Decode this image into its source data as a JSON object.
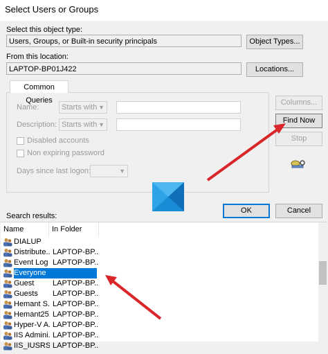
{
  "window": {
    "title": "Select Users or Groups"
  },
  "object_type": {
    "label": "Select this object type:",
    "value": "Users, Groups, or Built-in security principals",
    "button": "Object Types..."
  },
  "location": {
    "label": "From this location:",
    "value": "LAPTOP-BP01J422",
    "button": "Locations..."
  },
  "queries": {
    "tab": "Common Queries",
    "name_label": "Name:",
    "name_mode": "Starts with",
    "description_label": "Description:",
    "description_mode": "Starts with",
    "disabled_accounts": "Disabled accounts",
    "non_expiring": "Non expiring password",
    "days_label": "Days since last logon:"
  },
  "buttons": {
    "columns": "Columns...",
    "find_now": "Find Now",
    "stop": "Stop",
    "ok": "OK",
    "cancel": "Cancel"
  },
  "results": {
    "label": "Search results:",
    "col_name": "Name",
    "col_folder": "In Folder",
    "rows": [
      {
        "name": "DIALUP",
        "folder": ""
      },
      {
        "name": "Distribute...",
        "folder": "LAPTOP-BP..."
      },
      {
        "name": "Event Log ...",
        "folder": "LAPTOP-BP..."
      },
      {
        "name": "Everyone",
        "folder": ""
      },
      {
        "name": "Guest",
        "folder": "LAPTOP-BP..."
      },
      {
        "name": "Guests",
        "folder": "LAPTOP-BP..."
      },
      {
        "name": "Hemant S...",
        "folder": "LAPTOP-BP..."
      },
      {
        "name": "Hemant25...",
        "folder": "LAPTOP-BP..."
      },
      {
        "name": "Hyper-V A...",
        "folder": "LAPTOP-BP..."
      },
      {
        "name": "IIS Admini...",
        "folder": "LAPTOP-BP..."
      },
      {
        "name": "IIS_IUSRS",
        "folder": "LAPTOP-BP..."
      }
    ]
  },
  "colors": {
    "selection": "#0078d7",
    "arrow": "#d9262a"
  }
}
